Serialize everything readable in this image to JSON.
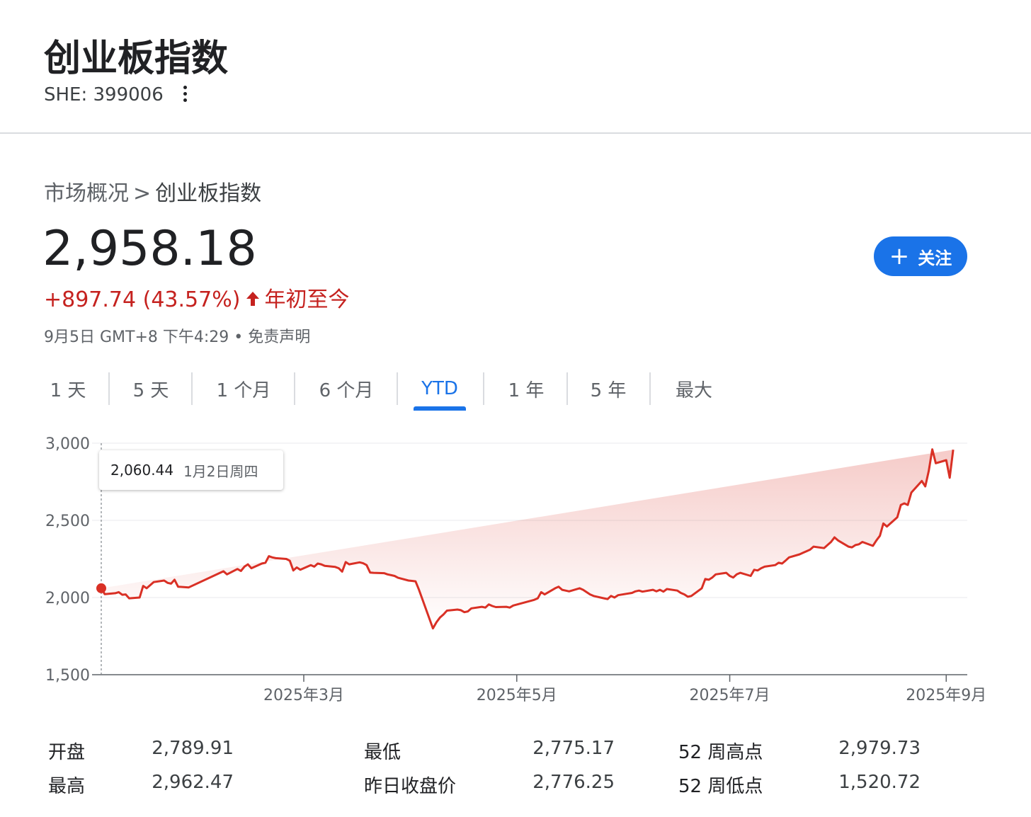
{
  "header": {
    "title": "创业板指数",
    "ticker": "SHE: 399006"
  },
  "breadcrumb": {
    "root": "市场概况",
    "separator": ">",
    "current": "创业板指数"
  },
  "quote": {
    "price": "2,958.18",
    "change": "+897.74 (43.57%)",
    "change_arrow": "🡑",
    "period_label": "年初至今",
    "timestamp": "9月5日 GMT+8 下午4:29",
    "bullet": "•",
    "disclaimer": "免责声明",
    "follow_label": "关注",
    "follow_icon": "plus-icon"
  },
  "tabs": [
    {
      "label": "1 天",
      "active": false
    },
    {
      "label": "5 天",
      "active": false
    },
    {
      "label": "1 个月",
      "active": false
    },
    {
      "label": "6 个月",
      "active": false
    },
    {
      "label": "YTD",
      "active": true
    },
    {
      "label": "1 年",
      "active": false
    },
    {
      "label": "5 年",
      "active": false
    },
    {
      "label": "最大",
      "active": false
    }
  ],
  "tooltip": {
    "value": "2,060.44",
    "date": "1月2日周四"
  },
  "colors": {
    "line": "#d93025",
    "fill": "#d93025",
    "accent": "#1a73e8",
    "negative_text": "#c5221f"
  },
  "chart_data": {
    "type": "area",
    "ylim": [
      1500,
      3000
    ],
    "yticks": [
      "3,000",
      "2,500",
      "2,000",
      "1,500"
    ],
    "ytick_values": [
      3000,
      2500,
      2000,
      1500
    ],
    "xtick_labels": [
      "2025年3月",
      "2025年5月",
      "2025年7月",
      "2025年9月"
    ],
    "xtick_dates": [
      "2025-03-01",
      "2025-05-01",
      "2025-07-01",
      "2025-09-01"
    ],
    "x_start": "2025-01-02",
    "x_end": "2025-09-05",
    "series": [
      {
        "dates": [
          "2025-01-02",
          "2025-01-03",
          "2025-01-06",
          "2025-01-07",
          "2025-01-08",
          "2025-01-09",
          "2025-01-10",
          "2025-01-13",
          "2025-01-14",
          "2025-01-15",
          "2025-01-16",
          "2025-01-17",
          "2025-01-20",
          "2025-01-21",
          "2025-01-22",
          "2025-01-23",
          "2025-01-24",
          "2025-01-27",
          "2025-02-05",
          "2025-02-06",
          "2025-02-07",
          "2025-02-10",
          "2025-02-11",
          "2025-02-12",
          "2025-02-13",
          "2025-02-14",
          "2025-02-17",
          "2025-02-18",
          "2025-02-19",
          "2025-02-20",
          "2025-02-21",
          "2025-02-24",
          "2025-02-25",
          "2025-02-26",
          "2025-02-27",
          "2025-02-28",
          "2025-03-03",
          "2025-03-04",
          "2025-03-05",
          "2025-03-06",
          "2025-03-07",
          "2025-03-10",
          "2025-03-11",
          "2025-03-12",
          "2025-03-13",
          "2025-03-14",
          "2025-03-17",
          "2025-03-18",
          "2025-03-19",
          "2025-03-20",
          "2025-03-21",
          "2025-03-24",
          "2025-03-25",
          "2025-03-26",
          "2025-03-27",
          "2025-03-28",
          "2025-03-31",
          "2025-04-01",
          "2025-04-02",
          "2025-04-03",
          "2025-04-07",
          "2025-04-08",
          "2025-04-09",
          "2025-04-10",
          "2025-04-11",
          "2025-04-14",
          "2025-04-15",
          "2025-04-16",
          "2025-04-17",
          "2025-04-18",
          "2025-04-21",
          "2025-04-22",
          "2025-04-23",
          "2025-04-24",
          "2025-04-25",
          "2025-04-28",
          "2025-04-29",
          "2025-04-30",
          "2025-05-06",
          "2025-05-07",
          "2025-05-08",
          "2025-05-09",
          "2025-05-12",
          "2025-05-13",
          "2025-05-14",
          "2025-05-15",
          "2025-05-16",
          "2025-05-19",
          "2025-05-20",
          "2025-05-21",
          "2025-05-22",
          "2025-05-23",
          "2025-05-26",
          "2025-05-27",
          "2025-05-28",
          "2025-05-29",
          "2025-05-30",
          "2025-06-03",
          "2025-06-04",
          "2025-06-05",
          "2025-06-06",
          "2025-06-09",
          "2025-06-10",
          "2025-06-11",
          "2025-06-12",
          "2025-06-13",
          "2025-06-16",
          "2025-06-17",
          "2025-06-18",
          "2025-06-19",
          "2025-06-20",
          "2025-06-23",
          "2025-06-24",
          "2025-06-25",
          "2025-06-26",
          "2025-06-27",
          "2025-06-30",
          "2025-07-01",
          "2025-07-02",
          "2025-07-03",
          "2025-07-04",
          "2025-07-07",
          "2025-07-08",
          "2025-07-09",
          "2025-07-10",
          "2025-07-11",
          "2025-07-14",
          "2025-07-15",
          "2025-07-16",
          "2025-07-17",
          "2025-07-18",
          "2025-07-21",
          "2025-07-22",
          "2025-07-23",
          "2025-07-24",
          "2025-07-25",
          "2025-07-28",
          "2025-07-29",
          "2025-07-30",
          "2025-07-31",
          "2025-08-01",
          "2025-08-04",
          "2025-08-05",
          "2025-08-06",
          "2025-08-07",
          "2025-08-08",
          "2025-08-11",
          "2025-08-12",
          "2025-08-13",
          "2025-08-14",
          "2025-08-15",
          "2025-08-18",
          "2025-08-19",
          "2025-08-20",
          "2025-08-21",
          "2025-08-22",
          "2025-08-25",
          "2025-08-26",
          "2025-08-27",
          "2025-08-28",
          "2025-08-29",
          "2025-09-01",
          "2025-09-02",
          "2025-09-03",
          "2025-09-04",
          "2025-09-05"
        ],
        "values": [
          2060,
          2022,
          2028,
          2035,
          2018,
          2020,
          1995,
          2000,
          2075,
          2060,
          2080,
          2100,
          2110,
          2095,
          2090,
          2115,
          2070,
          2065,
          2160,
          2170,
          2150,
          2185,
          2172,
          2200,
          2215,
          2190,
          2220,
          2225,
          2268,
          2260,
          2255,
          2250,
          2238,
          2175,
          2195,
          2180,
          2210,
          2200,
          2220,
          2215,
          2205,
          2198,
          2190,
          2168,
          2230,
          2215,
          2228,
          2222,
          2210,
          2162,
          2160,
          2158,
          2150,
          2145,
          2140,
          2128,
          2110,
          2108,
          2105,
          2050,
          1800,
          1840,
          1870,
          1890,
          1915,
          1922,
          1918,
          1905,
          1910,
          1930,
          1940,
          1935,
          1955,
          1945,
          1938,
          1940,
          1935,
          1948,
          1985,
          1995,
          2035,
          2020,
          2060,
          2070,
          2050,
          2045,
          2040,
          2060,
          2050,
          2035,
          2020,
          2010,
          1995,
          1990,
          2010,
          2000,
          2015,
          2030,
          2040,
          2045,
          2038,
          2050,
          2040,
          2050,
          2038,
          2055,
          2045,
          2030,
          2020,
          2005,
          2010,
          2060,
          2120,
          2115,
          2130,
          2150,
          2160,
          2140,
          2130,
          2150,
          2160,
          2140,
          2180,
          2175,
          2190,
          2200,
          2210,
          2225,
          2220,
          2240,
          2260,
          2280,
          2290,
          2300,
          2310,
          2330,
          2320,
          2340,
          2360,
          2390,
          2370,
          2330,
          2325,
          2340,
          2345,
          2360,
          2335,
          2370,
          2400,
          2480,
          2460,
          2520,
          2600,
          2610,
          2600,
          2680,
          2755,
          2720,
          2820,
          2960,
          2870,
          2890,
          2776,
          2958
        ]
      }
    ]
  },
  "stats": [
    {
      "label": "开盘",
      "value": "2,789.91"
    },
    {
      "label": "最高",
      "value": "2,962.47"
    },
    {
      "label": "最低",
      "value": "2,775.17"
    },
    {
      "label": "昨日收盘价",
      "value": "2,776.25"
    },
    {
      "label": "52 周高点",
      "value": "2,979.73"
    },
    {
      "label": "52 周低点",
      "value": "1,520.72"
    }
  ]
}
